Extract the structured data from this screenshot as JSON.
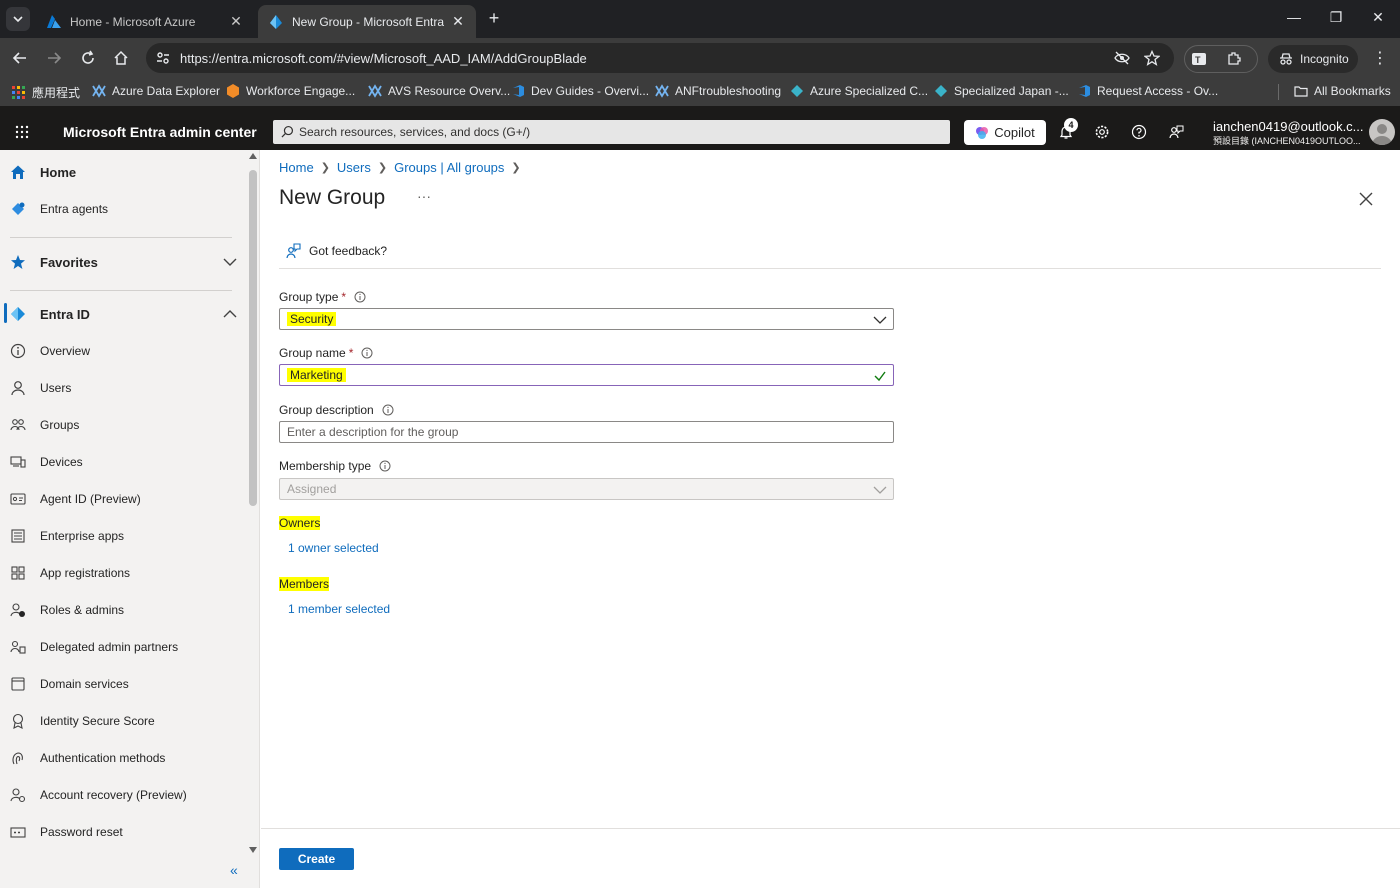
{
  "browser": {
    "tabs": [
      {
        "title": "Home - Microsoft Azure",
        "active": false
      },
      {
        "title": "New Group - Microsoft Entra admin center",
        "active": true
      }
    ],
    "url": "https://entra.microsoft.com/#view/Microsoft_AAD_IAM/AddGroupBlade",
    "incognito_label": "Incognito",
    "bookmarks": [
      {
        "label": "應用程式",
        "icon": "apps-grid-icon"
      },
      {
        "label": "Azure Data Explorer",
        "icon": "data-explorer-icon"
      },
      {
        "label": "Workforce Engage...",
        "icon": "workforce-icon"
      },
      {
        "label": "AVS Resource Overv...",
        "icon": "avs-icon"
      },
      {
        "label": "Dev Guides - Overvi...",
        "icon": "devops-icon"
      },
      {
        "label": "ANFtroubleshooting",
        "icon": "anf-icon"
      },
      {
        "label": "Azure Specialized C...",
        "icon": "azure-specialized-icon"
      },
      {
        "label": "Specialized Japan -...",
        "icon": "specialized-japan-icon"
      },
      {
        "label": "Request Access - Ov...",
        "icon": "request-access-icon"
      }
    ],
    "all_bookmarks_label": "All Bookmarks"
  },
  "header": {
    "app_title": "Microsoft Entra admin center",
    "search_placeholder": "Search resources, services, and docs (G+/)",
    "copilot_label": "Copilot",
    "notification_count": "4",
    "account_name": "ianchen0419@outlook.c...",
    "account_directory": "預設目錄 (IANCHEN0419OUTLOO..."
  },
  "leftnav": {
    "home": "Home",
    "entra_agents": "Entra agents",
    "favorites": "Favorites",
    "entra_id": "Entra ID",
    "items": [
      {
        "label": "Overview",
        "icon": "info-circle-icon"
      },
      {
        "label": "Users",
        "icon": "person-icon"
      },
      {
        "label": "Groups",
        "icon": "people-icon"
      },
      {
        "label": "Devices",
        "icon": "devices-icon"
      },
      {
        "label": "Agent ID (Preview)",
        "icon": "agent-id-icon"
      },
      {
        "label": "Enterprise apps",
        "icon": "enterprise-apps-icon"
      },
      {
        "label": "App registrations",
        "icon": "app-registrations-icon"
      },
      {
        "label": "Roles & admins",
        "icon": "roles-icon"
      },
      {
        "label": "Delegated admin partners",
        "icon": "partners-icon"
      },
      {
        "label": "Domain services",
        "icon": "domain-services-icon"
      },
      {
        "label": "Identity Secure Score",
        "icon": "secure-score-icon"
      },
      {
        "label": "Authentication methods",
        "icon": "auth-methods-icon"
      },
      {
        "label": "Account recovery (Preview)",
        "icon": "account-recovery-icon"
      },
      {
        "label": "Password reset",
        "icon": "password-reset-icon"
      }
    ]
  },
  "main": {
    "breadcrumb": [
      "Home",
      "Users",
      "Groups | All groups"
    ],
    "title": "New Group",
    "feedback_label": "Got feedback?",
    "group_type_label": "Group type",
    "group_type_value": "Security",
    "group_name_label": "Group name",
    "group_name_value": "Marketing",
    "group_description_label": "Group description",
    "group_description_placeholder": "Enter a description for the group",
    "membership_type_label": "Membership type",
    "membership_type_value": "Assigned",
    "owners_label": "Owners",
    "owners_value": "1 owner selected",
    "members_label": "Members",
    "members_value": "1 member selected",
    "create_label": "Create"
  },
  "colors": {
    "accent": "#0f6cbd",
    "highlight": "#ffff00",
    "header_bg": "#1b1a19",
    "required": "#a4262c"
  }
}
